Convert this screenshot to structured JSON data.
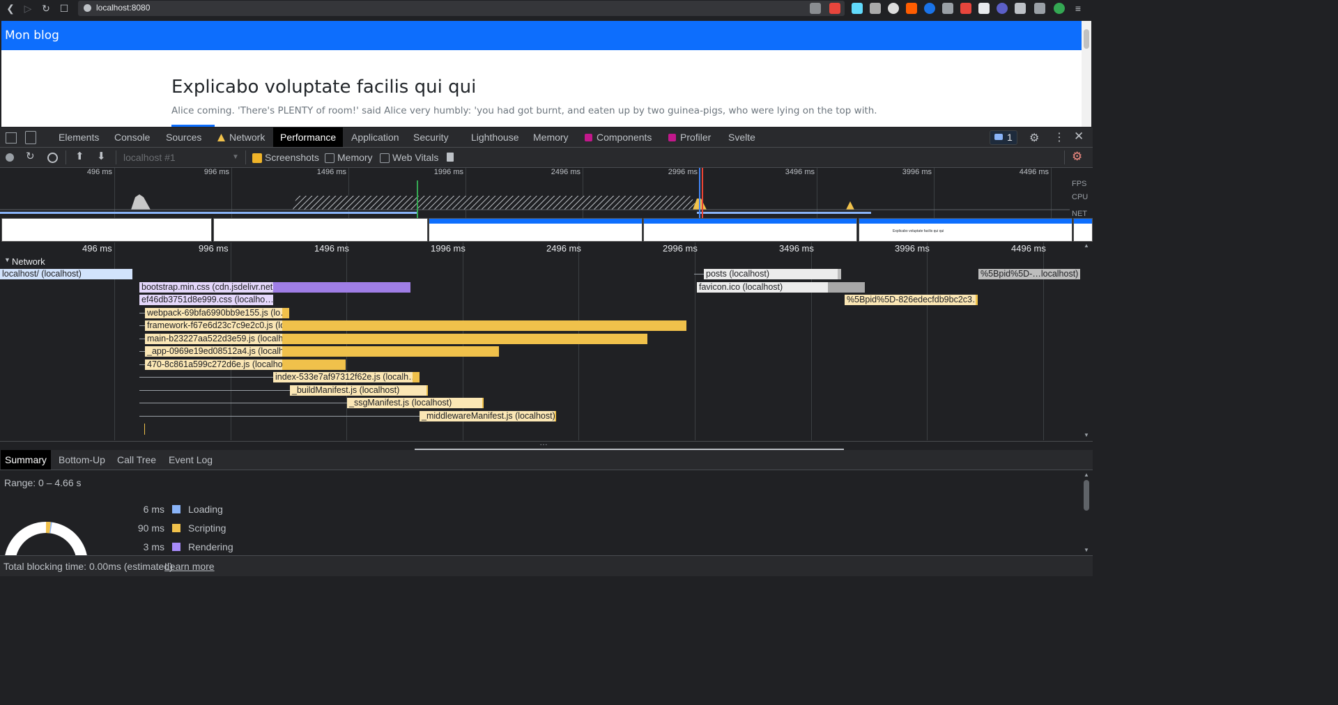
{
  "browser": {
    "url": "localhost:8080"
  },
  "page": {
    "brand": "Mon blog",
    "post_title": "Explicabo voluptate facilis qui qui",
    "post_excerpt": "Alice coming. 'There's PLENTY of room!' said Alice very humbly: 'you had got burnt, and eaten up by two guinea-pigs, who were lying on the top with."
  },
  "devtools": {
    "tabs": [
      "Elements",
      "Console",
      "Sources",
      "Network",
      "Performance",
      "Application",
      "Security",
      "Lighthouse",
      "Memory",
      "Components",
      "Profiler",
      "Svelte"
    ],
    "active_tab": "Performance",
    "message_count": "1",
    "toolbar": {
      "recording_select": "localhost #1",
      "screenshots_label": "Screenshots",
      "screenshots_checked": true,
      "memory_label": "Memory",
      "memory_checked": false,
      "webvitals_label": "Web Vitals",
      "webvitals_checked": false
    },
    "overview": {
      "ticks": [
        "496 ms",
        "996 ms",
        "1496 ms",
        "1996 ms",
        "2496 ms",
        "2996 ms",
        "3496 ms",
        "3996 ms",
        "4496 ms"
      ],
      "track_labels": [
        "FPS",
        "CPU",
        "NET"
      ],
      "screenshot_title": "Explicabo voluptate facilis qui qui"
    },
    "flamechart": {
      "ticks": [
        "496 ms",
        "996 ms",
        "1496 ms",
        "1996 ms",
        "2496 ms",
        "2996 ms",
        "3496 ms",
        "3996 ms",
        "4496 ms"
      ],
      "network_label": "Network",
      "requests": [
        {
          "label": "localhost/ (localhost)"
        },
        {
          "label": "bootstrap.min.css (cdn.jsdelivr.net)"
        },
        {
          "label": "ef46db3751d8e999.css (localho…"
        },
        {
          "label": "webpack-69bfa6990bb9e155.js (lo…"
        },
        {
          "label": "framework-f67e6d23c7c9e2c0.js (localhost)"
        },
        {
          "label": "main-b23227aa522d3e59.js (localhost)"
        },
        {
          "label": "_app-0969e19ed08512a4.js (localhost)"
        },
        {
          "label": "470-8c861a599c272d6e.js (localhost)"
        },
        {
          "label": "index-533e7af97312f62e.js (localh…"
        },
        {
          "label": "_buildManifest.js (localhost)"
        },
        {
          "label": "_ssgManifest.js (localhost)"
        },
        {
          "label": "_middlewareManifest.js (localhost)"
        },
        {
          "label": "posts (localhost)"
        },
        {
          "label": "favicon.ico (localhost)"
        },
        {
          "label": "%5Bpid%5D-826edecfdb9bc2c3…"
        },
        {
          "label": "%5Bpid%5D-…localhost)"
        }
      ]
    },
    "bottom_tabs": [
      "Summary",
      "Bottom-Up",
      "Call Tree",
      "Event Log"
    ],
    "active_bottom_tab": "Summary",
    "summary": {
      "range": "Range: 0 – 4.66 s",
      "rows": [
        {
          "value": "6 ms",
          "label": "Loading",
          "color": "#8ab4f8"
        },
        {
          "value": "90 ms",
          "label": "Scripting",
          "color": "#f0c14b"
        },
        {
          "value": "3 ms",
          "label": "Rendering",
          "color": "#a78bfa"
        }
      ]
    },
    "status": {
      "text": "Total blocking time: 0.00ms (estimated)",
      "link": "Learn more"
    }
  }
}
